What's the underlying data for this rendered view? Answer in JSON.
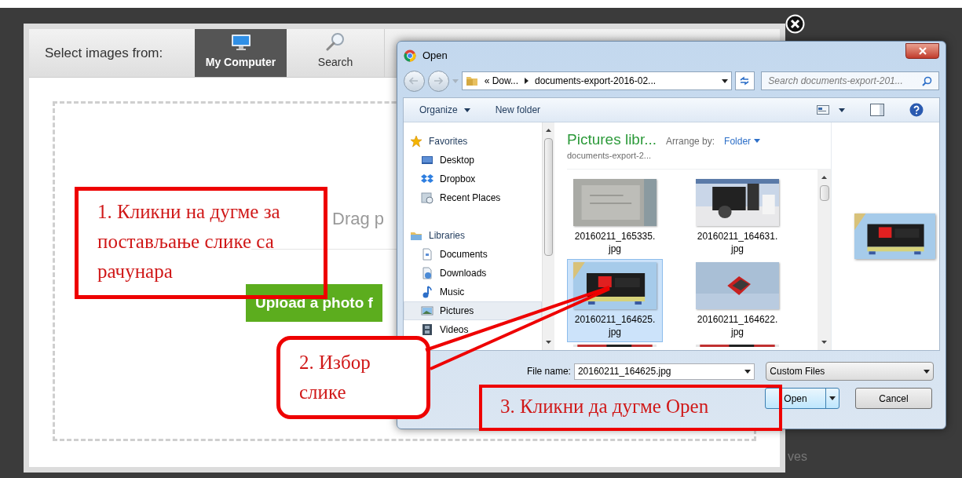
{
  "uploader": {
    "source_label": "Select images from:",
    "tabs": [
      {
        "label": "My Computer",
        "selected": true
      },
      {
        "label": "Search",
        "selected": false
      }
    ],
    "drop_hint": "Drag p",
    "upload_button": "Upload a photo f",
    "behind_text": "ves"
  },
  "dialog": {
    "title": "Open",
    "path": [
      "« Dow...",
      "documents-export-2016-02..."
    ],
    "search_placeholder": "Search documents-export-201...",
    "toolbar": [
      {
        "label": "Organize",
        "dropdown": true
      },
      {
        "label": "New folder",
        "dropdown": false
      }
    ],
    "nav": [
      {
        "label": "Favorites",
        "children": [
          {
            "label": "Desktop",
            "selected": false
          },
          {
            "label": "Dropbox",
            "selected": false
          },
          {
            "label": "Recent Places",
            "selected": false
          }
        ]
      },
      {
        "label": "Libraries",
        "children": [
          {
            "label": "Documents",
            "selected": false
          },
          {
            "label": "Downloads",
            "selected": false
          },
          {
            "label": "Music",
            "selected": false
          },
          {
            "label": "Pictures",
            "selected": true
          },
          {
            "label": "Videos",
            "selected": false
          }
        ]
      }
    ],
    "library": {
      "title": "Pictures libr...",
      "subtitle": "documents-export-2...",
      "arrange_label": "Arrange by:",
      "arrange_value": "Folder"
    },
    "files": [
      {
        "name": "20160211_165335.jpg",
        "selected": false
      },
      {
        "name": "20160211_164631.jpg",
        "selected": false
      },
      {
        "name": "20160211_164625.jpg",
        "selected": true
      },
      {
        "name": "20160211_164622.jpg",
        "selected": false
      }
    ],
    "file_name_label": "File name:",
    "file_name": "20160211_164625.jpg",
    "file_type": "Custom Files",
    "buttons": [
      {
        "label": "Open",
        "kind": "split"
      },
      {
        "label": "Cancel",
        "kind": "plain"
      }
    ]
  },
  "annotations": [
    {
      "kind": "rect",
      "text": "1. Кликни на дугме за постављање слике са рачунара"
    },
    {
      "kind": "callout",
      "text": "2. Избор слике"
    },
    {
      "kind": "rect",
      "text": "3. Кликни да дугме Open"
    }
  ]
}
